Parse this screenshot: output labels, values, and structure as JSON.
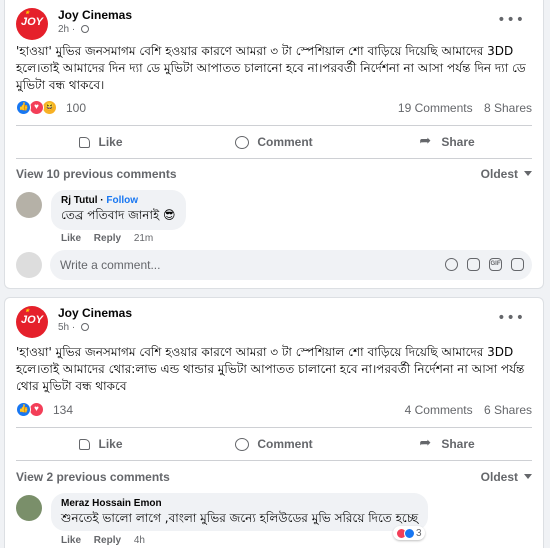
{
  "colors": {
    "accent": "#1877f2",
    "brand": "#e5202b",
    "love": "#f33e58",
    "haha": "#f7b125"
  },
  "posts": [
    {
      "page_name": "Joy Cinemas",
      "logo_text": "JOY",
      "time": "2h",
      "text": "'হাওয়া' মুভির জনসমাগম বেশি হওয়ার কারণে আমরা ৩ টা স্পেশিয়াল শো বাড়িয়ে দিয়েছি আমাদের 3DD হলে।তাই আমাদের দিন দ্যা ডে মুভিটা আপাতত চালানো হবে না।পরবর্তী নির্দেশনা না আসা পর্যন্ত দিন দ্যা ডে মুভিটা বন্ধ থাকবে।",
      "reactions": [
        "like-icon",
        "love-icon",
        "haha-icon"
      ],
      "reaction_count": "100",
      "comments_count": "19 Comments",
      "shares_count": "8 Shares",
      "actions": {
        "like": "Like",
        "comment": "Comment",
        "share": "Share"
      },
      "view_previous": "View 10 previous comments",
      "sort": "Oldest",
      "comment": {
        "author": "Rj Tutul",
        "follow": "Follow",
        "text": "তেব্র পতিবাদ জানাই 😎",
        "like": "Like",
        "reply": "Reply",
        "time": "21m"
      },
      "write_placeholder": "Write a comment...",
      "write_tools": [
        "emoji-icon",
        "camera-icon",
        "gif-icon",
        "sticker-icon"
      ]
    },
    {
      "page_name": "Joy Cinemas",
      "logo_text": "JOY",
      "time": "5h",
      "text": "'হাওয়া' মুভির জনসমাগম বেশি হওয়ার কারণে আমরা ৩ টা স্পেশিয়াল শো বাড়িয়ে দিয়েছি আমাদের 3DD হলে।তাই আমাদের থোর:লাভ এন্ড থান্ডার মুভিটা আপাতত চালানো হবে না।পরবর্তী নির্দেশনা না আসা পর্যন্ত থোর মুভিটা বন্ধ থাকবে",
      "reactions": [
        "like-icon",
        "love-icon"
      ],
      "reaction_count": "134",
      "comments_count": "4 Comments",
      "shares_count": "6 Shares",
      "actions": {
        "like": "Like",
        "comment": "Comment",
        "share": "Share"
      },
      "view_previous": "View 2 previous comments",
      "sort": "Oldest",
      "comment": {
        "author": "Meraz Hossain Emon",
        "text": "শুনতেই ভালো লাগে ,বাংলা মুভির জন্যে হলিউডের মুভি সরিয়ে দিতে হচ্ছে",
        "like": "Like",
        "reply": "Reply",
        "time": "4h",
        "reaction_count": "3"
      }
    }
  ]
}
